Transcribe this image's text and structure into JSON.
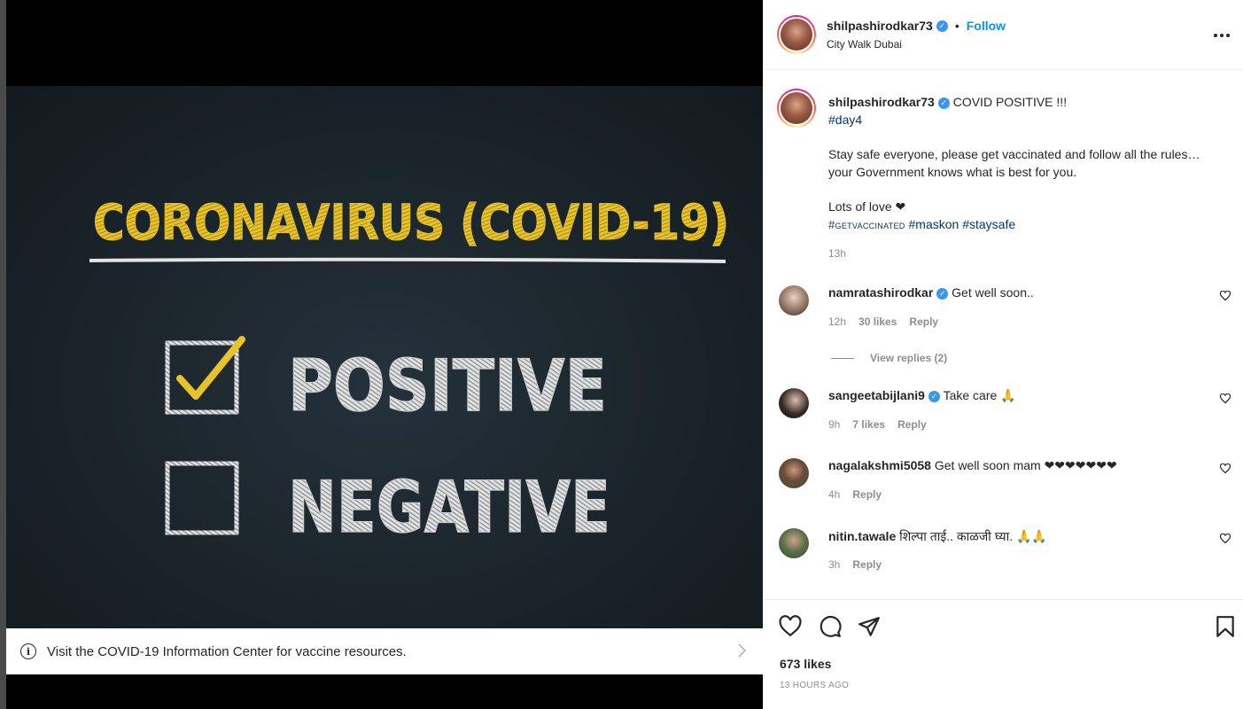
{
  "photo": {
    "title": "CORONAVIRUS (COVID-19)",
    "option_positive": "POSITIVE",
    "option_negative": "NEGATIVE"
  },
  "info_bar": {
    "icon": "info-icon",
    "text": "Visit the COVID-19 Information Center for vaccine resources."
  },
  "header": {
    "username": "shilpashirodkar73",
    "follow_label": "Follow",
    "separator": "•",
    "location": "City Walk Dubai"
  },
  "caption": {
    "username": "shilpashirodkar73",
    "headline": "COVID POSITIVE !!!",
    "hashtag_day": "#day4",
    "line1": "Stay safe everyone, please get vaccinated and follow all the rules…",
    "line2": "your Government knows what is best for you.",
    "line3": "Lots of love ❤",
    "tag1": "#getvaccinated",
    "tag2": "#maskon",
    "tag3": "#staysafe",
    "time": "13h"
  },
  "comments": [
    {
      "username": "namratashirodkar",
      "text": "Get well soon..",
      "time": "12h",
      "likes": "30 likes",
      "reply": "Reply",
      "verified": true
    },
    {
      "username": "sangeetabijlani9",
      "text": "Take care 🙏",
      "time": "9h",
      "likes": "7 likes",
      "reply": "Reply",
      "verified": true
    },
    {
      "username": "nagalakshmi5058",
      "text": "Get well soon mam ❤❤❤❤❤❤❤",
      "time": "4h",
      "likes": "",
      "reply": "Reply",
      "verified": false
    },
    {
      "username": "nitin.tawale",
      "text": "शिल्पा ताई.. काळजी घ्या. 🙏🙏",
      "time": "3h",
      "likes": "",
      "reply": "Reply",
      "verified": false
    }
  ],
  "view_replies": "View replies (2)",
  "footer": {
    "likes": "673 likes",
    "time_ago": "13 HOURS AGO"
  },
  "colors": {
    "chalk_yellow": "#e8c22a",
    "chalk_white": "#e6e6e6",
    "link_blue": "#0095f6",
    "hashtag": "#00376b"
  }
}
